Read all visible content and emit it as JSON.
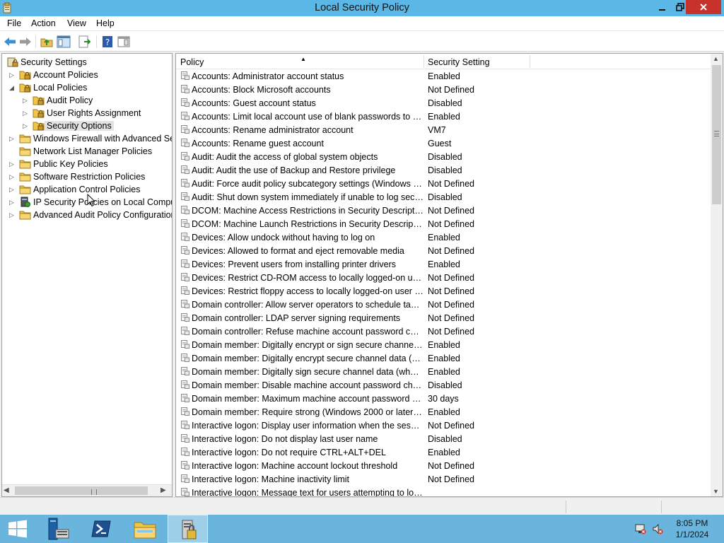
{
  "window": {
    "title": "Local Security Policy"
  },
  "menu": [
    "File",
    "Action",
    "View",
    "Help"
  ],
  "tree": [
    {
      "label": "Security Settings",
      "level": 0,
      "expander": "none",
      "icon": "security-settings-icon"
    },
    {
      "label": "Account Policies",
      "level": 1,
      "expander": "collapsed",
      "icon": "folder-lock-icon"
    },
    {
      "label": "Local Policies",
      "level": 1,
      "expander": "expanded",
      "icon": "folder-lock-icon"
    },
    {
      "label": "Audit Policy",
      "level": 2,
      "expander": "collapsed",
      "icon": "folder-lock-icon"
    },
    {
      "label": "User Rights Assignment",
      "level": 2,
      "expander": "collapsed",
      "icon": "folder-lock-icon"
    },
    {
      "label": "Security Options",
      "level": 2,
      "expander": "collapsed",
      "icon": "folder-lock-icon",
      "selected": true
    },
    {
      "label": "Windows Firewall with Advanced Security",
      "level": 1,
      "expander": "collapsed",
      "icon": "folder-icon"
    },
    {
      "label": "Network List Manager Policies",
      "level": 1,
      "expander": "none",
      "icon": "folder-icon"
    },
    {
      "label": "Public Key Policies",
      "level": 1,
      "expander": "collapsed",
      "icon": "folder-icon"
    },
    {
      "label": "Software Restriction Policies",
      "level": 1,
      "expander": "collapsed",
      "icon": "folder-icon"
    },
    {
      "label": "Application Control Policies",
      "level": 1,
      "expander": "collapsed",
      "icon": "folder-icon"
    },
    {
      "label": "IP Security Policies on Local Computer",
      "level": 1,
      "expander": "collapsed",
      "icon": "ipsec-icon"
    },
    {
      "label": "Advanced Audit Policy Configuration",
      "level": 1,
      "expander": "collapsed",
      "icon": "folder-icon"
    }
  ],
  "columns": {
    "policy": "Policy",
    "setting": "Security Setting"
  },
  "rows": [
    {
      "policy": "Accounts: Administrator account status",
      "setting": "Enabled"
    },
    {
      "policy": "Accounts: Block Microsoft accounts",
      "setting": "Not Defined"
    },
    {
      "policy": "Accounts: Guest account status",
      "setting": "Disabled"
    },
    {
      "policy": "Accounts: Limit local account use of blank passwords to co...",
      "setting": "Enabled"
    },
    {
      "policy": "Accounts: Rename administrator account",
      "setting": "VM7"
    },
    {
      "policy": "Accounts: Rename guest account",
      "setting": "Guest"
    },
    {
      "policy": "Audit: Audit the access of global system objects",
      "setting": "Disabled"
    },
    {
      "policy": "Audit: Audit the use of Backup and Restore privilege",
      "setting": "Disabled"
    },
    {
      "policy": "Audit: Force audit policy subcategory settings (Windows Vis...",
      "setting": "Not Defined"
    },
    {
      "policy": "Audit: Shut down system immediately if unable to log secur...",
      "setting": "Disabled"
    },
    {
      "policy": "DCOM: Machine Access Restrictions in Security Descriptor D...",
      "setting": "Not Defined"
    },
    {
      "policy": "DCOM: Machine Launch Restrictions in Security Descriptor ...",
      "setting": "Not Defined"
    },
    {
      "policy": "Devices: Allow undock without having to log on",
      "setting": "Enabled"
    },
    {
      "policy": "Devices: Allowed to format and eject removable media",
      "setting": "Not Defined"
    },
    {
      "policy": "Devices: Prevent users from installing printer drivers",
      "setting": "Enabled"
    },
    {
      "policy": "Devices: Restrict CD-ROM access to locally logged-on user ...",
      "setting": "Not Defined"
    },
    {
      "policy": "Devices: Restrict floppy access to locally logged-on user only",
      "setting": "Not Defined"
    },
    {
      "policy": "Domain controller: Allow server operators to schedule tasks",
      "setting": "Not Defined"
    },
    {
      "policy": "Domain controller: LDAP server signing requirements",
      "setting": "Not Defined"
    },
    {
      "policy": "Domain controller: Refuse machine account password chan...",
      "setting": "Not Defined"
    },
    {
      "policy": "Domain member: Digitally encrypt or sign secure channel d...",
      "setting": "Enabled"
    },
    {
      "policy": "Domain member: Digitally encrypt secure channel data (wh...",
      "setting": "Enabled"
    },
    {
      "policy": "Domain member: Digitally sign secure channel data (when ...",
      "setting": "Enabled"
    },
    {
      "policy": "Domain member: Disable machine account password chan...",
      "setting": "Disabled"
    },
    {
      "policy": "Domain member: Maximum machine account password age",
      "setting": "30 days"
    },
    {
      "policy": "Domain member: Require strong (Windows 2000 or later) se...",
      "setting": "Enabled"
    },
    {
      "policy": "Interactive logon: Display user information when the session...",
      "setting": "Not Defined"
    },
    {
      "policy": "Interactive logon: Do not display last user name",
      "setting": "Disabled"
    },
    {
      "policy": "Interactive logon: Do not require CTRL+ALT+DEL",
      "setting": "Enabled"
    },
    {
      "policy": "Interactive logon: Machine account lockout threshold",
      "setting": "Not Defined"
    },
    {
      "policy": "Interactive logon: Machine inactivity limit",
      "setting": "Not Defined"
    },
    {
      "policy": "Interactive logon: Message text for users attempting to log on",
      "setting": ""
    }
  ],
  "taskbar": {
    "buttons": [
      "start-button",
      "server-manager-button",
      "powershell-button",
      "file-explorer-button",
      "local-security-policy-button"
    ],
    "clock": {
      "time": "8:05 PM",
      "date": "1/1/2024"
    }
  },
  "colors": {
    "titlebar": "#5bb8e6",
    "close": "#c7322a",
    "taskbar": "#6ab5de"
  }
}
